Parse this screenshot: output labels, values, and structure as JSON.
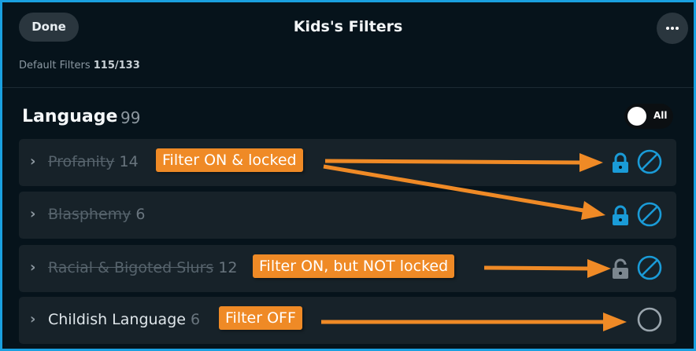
{
  "header": {
    "done_label": "Done",
    "title": "Kids's Filters",
    "more_icon": "more-dots-icon",
    "subtitle_label": "Default Filters",
    "subtitle_value": "115/133"
  },
  "section": {
    "title": "Language",
    "count": "99",
    "toggle_label": "All",
    "toggle_on": true
  },
  "rows": [
    {
      "label": "Profanity",
      "count": "14",
      "filtered": true,
      "locked": true
    },
    {
      "label": "Blasphemy",
      "count": "6",
      "filtered": true,
      "locked": true
    },
    {
      "label": "Racial & Bigoted Slurs",
      "count": "12",
      "filtered": true,
      "locked": false
    },
    {
      "label": "Childish Language",
      "count": "6",
      "filtered": false,
      "locked": false
    }
  ],
  "annotations": [
    "Filter ON & locked",
    "Filter ON, but NOT locked",
    "Filter OFF"
  ],
  "colors": {
    "background": "#06131b",
    "row": "#172229",
    "accent_blue": "#1a9bd7",
    "unlocked_gray": "#7c878f",
    "annotation": "#ef8a26",
    "frame_border": "#1aa0e0"
  }
}
